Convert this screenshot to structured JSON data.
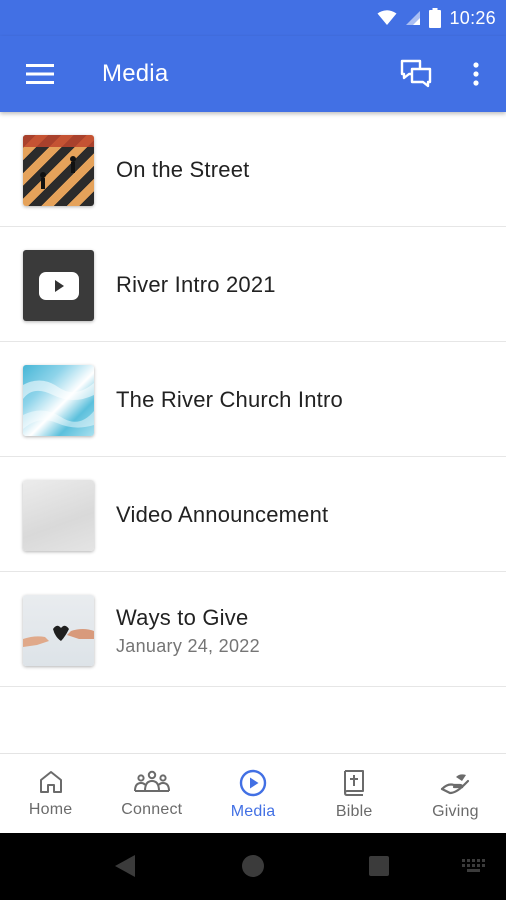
{
  "status": {
    "time": "10:26"
  },
  "appbar": {
    "title": "Media"
  },
  "colors": {
    "accent": "#4270e4",
    "text": "#222222",
    "muted": "#757575"
  },
  "items": [
    {
      "title": "On the Street",
      "subtitle": "",
      "thumb": "street-photo"
    },
    {
      "title": "River Intro 2021",
      "subtitle": "",
      "thumb": "youtube-logo"
    },
    {
      "title": "The River Church Intro",
      "subtitle": "",
      "thumb": "water-photo"
    },
    {
      "title": "Video Announcement",
      "subtitle": "",
      "thumb": "paper-photo"
    },
    {
      "title": "Ways to Give",
      "subtitle": "January 24, 2022",
      "thumb": "hands-photo"
    }
  ],
  "tabs": [
    {
      "label": "Home",
      "icon": "home-icon",
      "active": false
    },
    {
      "label": "Connect",
      "icon": "people-icon",
      "active": false
    },
    {
      "label": "Media",
      "icon": "play-circle-icon",
      "active": true
    },
    {
      "label": "Bible",
      "icon": "bible-icon",
      "active": false
    },
    {
      "label": "Giving",
      "icon": "giving-hand-icon",
      "active": false
    }
  ]
}
